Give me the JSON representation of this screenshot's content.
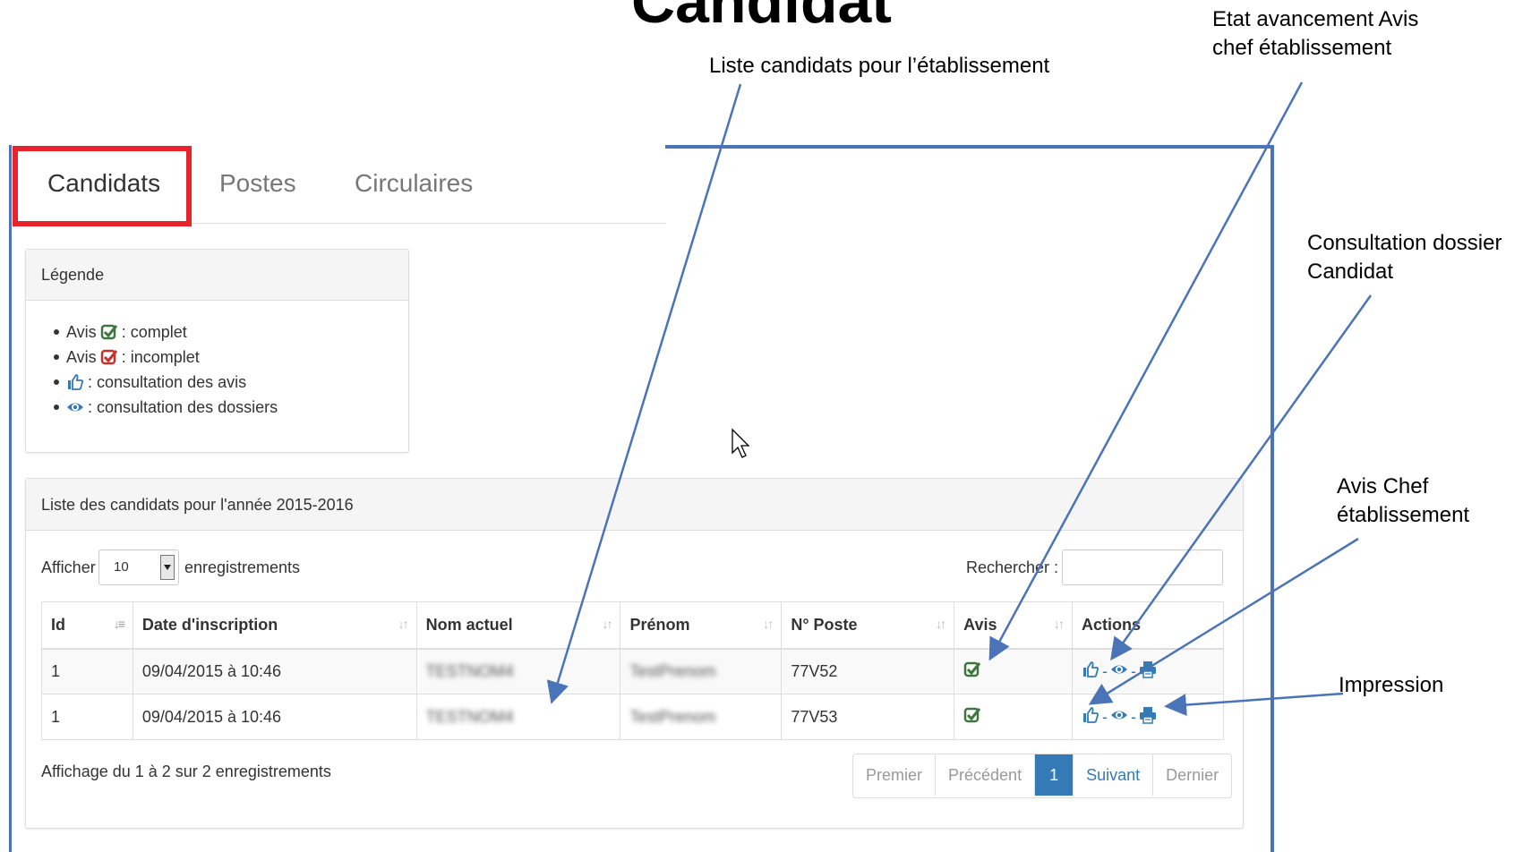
{
  "slide": {
    "title": "Candidat",
    "callouts": {
      "liste": "Liste candidats  pour l’établissement",
      "etat_line1": "Etat avancement  Avis",
      "etat_line2": "chef établissement",
      "consult_line1": "Consultation dossier",
      "consult_line2": "Candidat",
      "avis_line1": "Avis Chef",
      "avis_line2": "établissement",
      "impression": "Impression"
    },
    "arrow_color": "#4a73b8",
    "highlight_color": "#e8232b"
  },
  "tabs": [
    {
      "label": "Candidats",
      "active": true
    },
    {
      "label": "Postes",
      "active": false
    },
    {
      "label": "Circulaires",
      "active": false
    }
  ],
  "legend": {
    "title": "Légende",
    "items": [
      {
        "prefix": "Avis",
        "icon": "check-square-green-icon",
        "text": ": complet"
      },
      {
        "prefix": "Avis",
        "icon": "check-square-red-icon",
        "text": ": incomplet"
      },
      {
        "prefix": "",
        "icon": "thumbs-up-icon",
        "text": ": consultation des avis"
      },
      {
        "prefix": "",
        "icon": "eye-icon",
        "text": ": consultation des dossiers"
      }
    ]
  },
  "list": {
    "title": "Liste des candidats pour l'année 2015-2016",
    "show_label": "Afficher",
    "page_size": "10",
    "records_label": "enregistrements",
    "search_label": "Rechercher :",
    "search_value": "",
    "columns": [
      "Id",
      "Date d'inscription",
      "Nom actuel",
      "Prénom",
      "N° Poste",
      "Avis",
      "Actions"
    ],
    "rows": [
      {
        "id": "1",
        "date": "09/04/2015 à 10:46",
        "nom": "TESTNOM4",
        "prenom": "TestPrenom",
        "poste": "77V52"
      },
      {
        "id": "1",
        "date": "09/04/2015 à 10:46",
        "nom": "TESTNOM4",
        "prenom": "TestPrenom",
        "poste": "77V53"
      }
    ],
    "action_separator": "-",
    "info": "Affichage du 1 à 2 sur 2 enregistrements",
    "pagination": [
      "Premier",
      "Précédent",
      "1",
      "Suivant",
      "Dernier"
    ],
    "current_page": "1"
  },
  "colors": {
    "primary": "#337ab7",
    "success": "#3c763d",
    "danger": "#c9302c"
  }
}
